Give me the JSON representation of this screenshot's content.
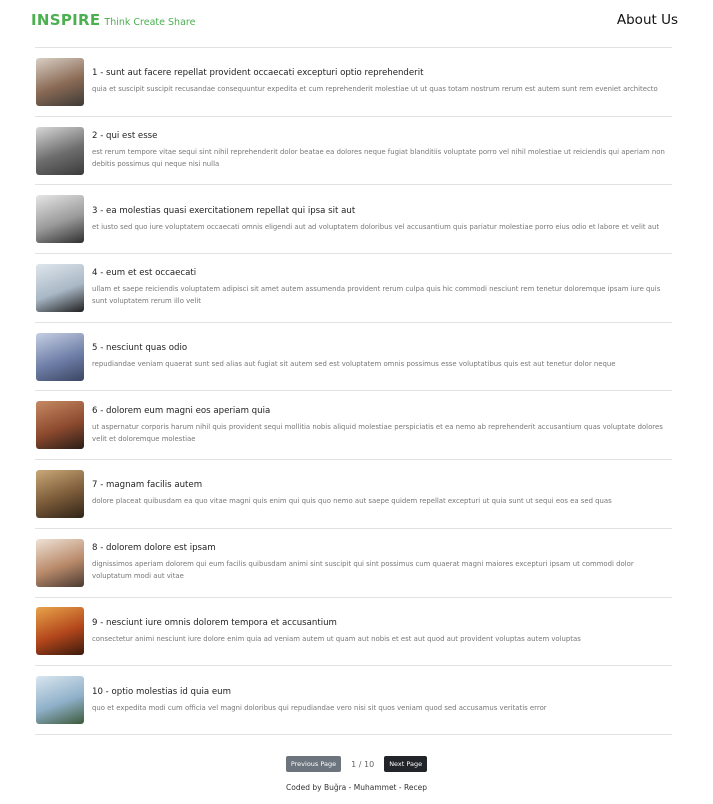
{
  "header": {
    "brand": "INSPIRE",
    "tagline": "Think Create Share",
    "about_link": "About Us"
  },
  "posts": [
    {
      "title": "1 - sunt aut facere repellat provident occaecati excepturi optio reprehenderit",
      "body": "quia et suscipit suscipit recusandae consequuntur expedita et cum reprehenderit molestiae ut ut quas totam nostrum rerum est autem sunt rem eveniet architecto",
      "thumb_colors": [
        "#8a6a55",
        "#d9cfc4",
        "#3e3a36"
      ]
    },
    {
      "title": "2 - qui est esse",
      "body": "est rerum tempore vitae sequi sint nihil reprehenderit dolor beatae ea dolores neque fugiat blanditiis voluptate porro vel nihil molestiae ut reiciendis qui aperiam non debitis possimus qui neque nisi nulla",
      "thumb_colors": [
        "#6d6d6d",
        "#d8d8d8",
        "#3a3a3a"
      ]
    },
    {
      "title": "3 - ea molestias quasi exercitationem repellat qui ipsa sit aut",
      "body": "et iusto sed quo iure voluptatem occaecati omnis eligendi aut ad voluptatem doloribus vel accusantium quis pariatur molestiae porro eius odio et labore et velit aut",
      "thumb_colors": [
        "#9a9a9a",
        "#e6e6e6",
        "#2f2f2f"
      ]
    },
    {
      "title": "4 - eum et est occaecati",
      "body": "ullam et saepe reiciendis voluptatem adipisci sit amet autem assumenda provident rerum culpa quis hic commodi nesciunt rem tenetur doloremque ipsam iure quis sunt voluptatem rerum illo velit",
      "thumb_colors": [
        "#a9b8c6",
        "#dfe6ec",
        "#1f1f1f"
      ]
    },
    {
      "title": "5 - nesciunt quas odio",
      "body": "repudiandae veniam quaerat sunt sed alias aut fugiat sit autem sed est voluptatem omnis possimus esse voluptatibus quis est aut tenetur dolor neque",
      "thumb_colors": [
        "#6f7fa8",
        "#c6cfe3",
        "#3b4563"
      ]
    },
    {
      "title": "6 - dolorem eum magni eos aperiam quia",
      "body": "ut aspernatur corporis harum nihil quis provident sequi mollitia nobis aliquid molestiae perspiciatis et ea nemo ab reprehenderit accusantium quas voluptate dolores velit et doloremque molestiae",
      "thumb_colors": [
        "#8d4a2f",
        "#c58a63",
        "#2a1d17"
      ]
    },
    {
      "title": "7 - magnam facilis autem",
      "body": "dolore placeat quibusdam ea quo vitae magni quis enim qui quis quo nemo aut saepe quidem repellat excepturi ut quia sunt ut sequi eos ea sed quas",
      "thumb_colors": [
        "#7a5a38",
        "#c9a877",
        "#2f2418"
      ]
    },
    {
      "title": "8 - dolorem dolore est ipsam",
      "body": "dignissimos aperiam dolorem qui eum facilis quibusdam animi sint suscipit qui sint possimus cum quaerat magni maiores excepturi ipsam ut commodi dolor voluptatum modi aut vitae",
      "thumb_colors": [
        "#b98a6a",
        "#efe2d6",
        "#4a3a33"
      ]
    },
    {
      "title": "9 - nesciunt iure omnis dolorem tempora et accusantium",
      "body": "consectetur animi nesciunt iure dolore enim quia ad veniam autem ut quam aut nobis et est aut quod aut provident voluptas autem voluptas",
      "thumb_colors": [
        "#b3461c",
        "#e8a44a",
        "#3a1a0c"
      ]
    },
    {
      "title": "10 - optio molestias id quia eum",
      "body": "quo et expedita modi cum officia vel magni doloribus qui repudiandae vero nisi sit quos veniam quod sed accusamus veritatis error",
      "thumb_colors": [
        "#8fb0c9",
        "#d9e6ef",
        "#3d5a3a"
      ]
    }
  ],
  "pagination": {
    "prev_label": "Previous Page",
    "page_info": "1 / 10",
    "next_label": "Next Page"
  },
  "footer": {
    "credits": "Coded by Buğra - Muhammet - Recep"
  }
}
